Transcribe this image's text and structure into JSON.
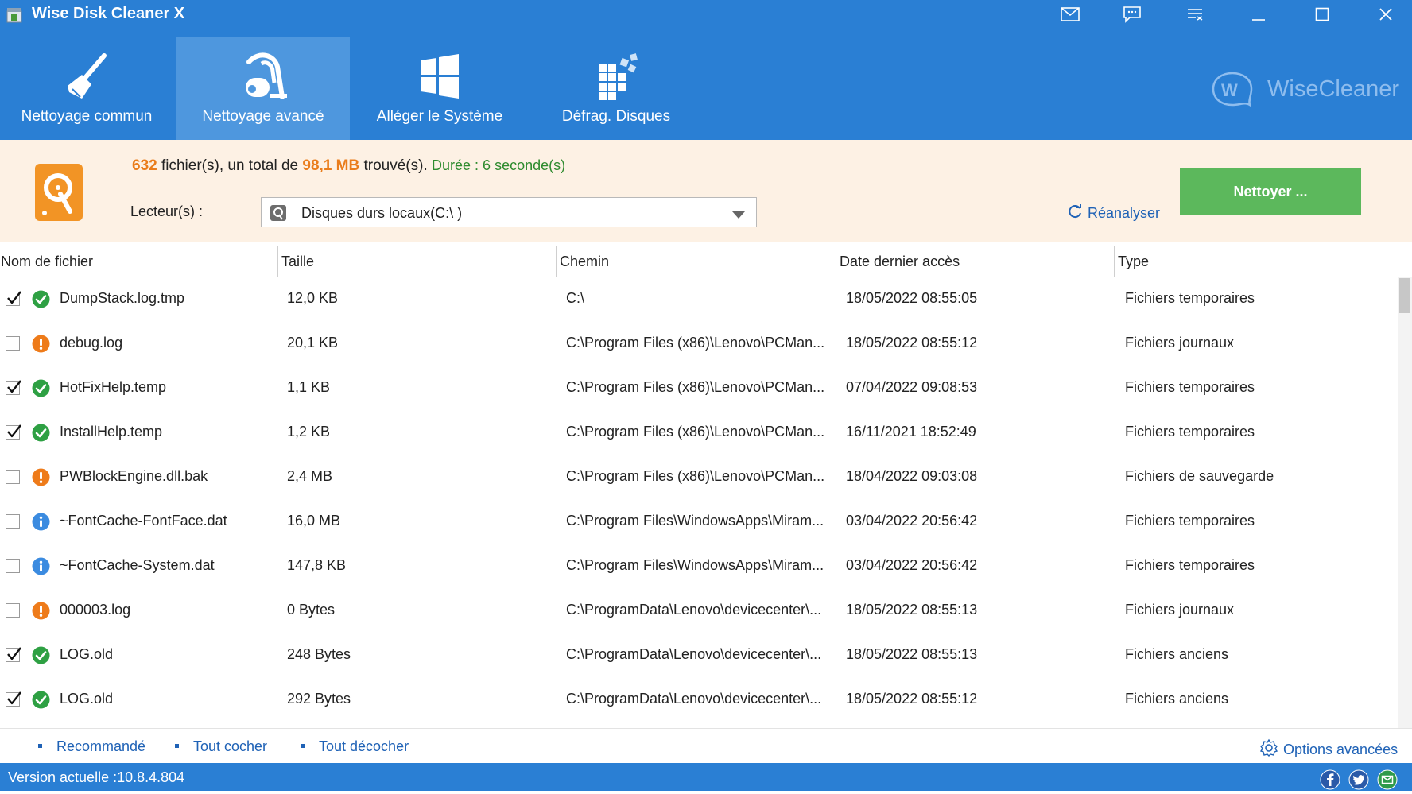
{
  "window": {
    "title": "Wise Disk Cleaner X",
    "controls": [
      "mail-icon",
      "feedback-icon",
      "menu-icon",
      "minimize-icon",
      "maximize-icon",
      "close-icon"
    ]
  },
  "nav": {
    "tabs": [
      {
        "label": "Nettoyage commun",
        "icon": "broom-icon",
        "active": false
      },
      {
        "label": "Nettoyage avancé",
        "icon": "vacuum-icon",
        "active": true
      },
      {
        "label": "Alléger le Système",
        "icon": "windows-icon",
        "active": false
      },
      {
        "label": "Défrag. Disques",
        "icon": "defrag-icon",
        "active": false
      }
    ],
    "brand": "WiseCleaner"
  },
  "summary": {
    "count": "632",
    "text1": "fichier(s), un total de",
    "size": "98,1 MB",
    "text2": "trouvé(s).",
    "duration": "Durée : 6 seconde(s)",
    "drives_label": "Lecteur(s) :",
    "drive_value": "Disques durs locaux(C:\\ )",
    "rescan_label": "Réanalyser",
    "clean_button": "Nettoyer ..."
  },
  "table": {
    "headers": [
      "Nom de fichier",
      "Taille",
      "Chemin",
      "Date dernier accès",
      "Type"
    ],
    "rows": [
      {
        "checked": true,
        "status": "ok",
        "name": "DumpStack.log.tmp",
        "size": "12,0 KB",
        "path": "C:\\",
        "date": "18/05/2022 08:55:05",
        "type": "Fichiers temporaires"
      },
      {
        "checked": false,
        "status": "warn",
        "name": "debug.log",
        "size": "20,1 KB",
        "path": "C:\\Program Files (x86)\\Lenovo\\PCMan...",
        "date": "18/05/2022 08:55:12",
        "type": "Fichiers journaux"
      },
      {
        "checked": true,
        "status": "ok",
        "name": "HotFixHelp.temp",
        "size": "1,1 KB",
        "path": "C:\\Program Files (x86)\\Lenovo\\PCMan...",
        "date": "07/04/2022 09:08:53",
        "type": "Fichiers temporaires"
      },
      {
        "checked": true,
        "status": "ok",
        "name": "InstallHelp.temp",
        "size": "1,2 KB",
        "path": "C:\\Program Files (x86)\\Lenovo\\PCMan...",
        "date": "16/11/2021 18:52:49",
        "type": "Fichiers temporaires"
      },
      {
        "checked": false,
        "status": "warn",
        "name": "PWBlockEngine.dll.bak",
        "size": "2,4 MB",
        "path": "C:\\Program Files (x86)\\Lenovo\\PCMan...",
        "date": "18/04/2022 09:03:08",
        "type": "Fichiers de sauvegarde"
      },
      {
        "checked": false,
        "status": "info",
        "name": "~FontCache-FontFace.dat",
        "size": "16,0 MB",
        "path": "C:\\Program Files\\WindowsApps\\Miram...",
        "date": "03/04/2022 20:56:42",
        "type": "Fichiers temporaires"
      },
      {
        "checked": false,
        "status": "info",
        "name": "~FontCache-System.dat",
        "size": "147,8 KB",
        "path": "C:\\Program Files\\WindowsApps\\Miram...",
        "date": "03/04/2022 20:56:42",
        "type": "Fichiers temporaires"
      },
      {
        "checked": false,
        "status": "warn",
        "name": "000003.log",
        "size": "0 Bytes",
        "path": "C:\\ProgramData\\Lenovo\\devicecenter\\...",
        "date": "18/05/2022 08:55:13",
        "type": "Fichiers journaux"
      },
      {
        "checked": true,
        "status": "ok",
        "name": "LOG.old",
        "size": "248 Bytes",
        "path": "C:\\ProgramData\\Lenovo\\devicecenter\\...",
        "date": "18/05/2022 08:55:13",
        "type": "Fichiers anciens"
      },
      {
        "checked": true,
        "status": "ok",
        "name": "LOG.old",
        "size": "292 Bytes",
        "path": "C:\\ProgramData\\Lenovo\\devicecenter\\...",
        "date": "18/05/2022 08:55:12",
        "type": "Fichiers anciens"
      }
    ]
  },
  "footer": {
    "links": [
      "Recommandé",
      "Tout cocher",
      "Tout décocher"
    ],
    "advanced": "Options avancées"
  },
  "status": {
    "version": "Version actuelle :10.8.4.804",
    "social": [
      "facebook-icon",
      "twitter-icon",
      "email-icon"
    ]
  },
  "colors": {
    "primary": "#2a7fd4",
    "active_tab": "#4e97de",
    "summary_bg": "#fdf1e4",
    "highlight": "#ea7d1c",
    "clean_button": "#5cb85c",
    "ok": "#2ea043",
    "warn": "#ee7b1a",
    "info": "#3b8be0"
  }
}
